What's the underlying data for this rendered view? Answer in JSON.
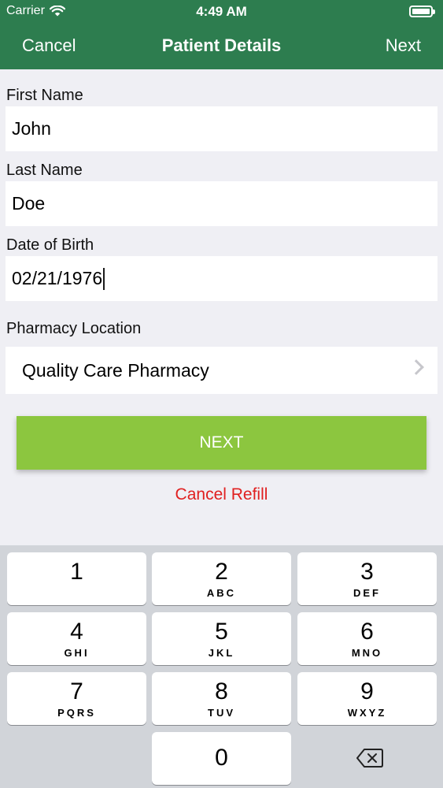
{
  "status_bar": {
    "carrier": "Carrier",
    "time": "4:49 AM"
  },
  "nav": {
    "cancel": "Cancel",
    "title": "Patient Details",
    "next": "Next"
  },
  "form": {
    "first_name_label": "First Name",
    "first_name_value": "John",
    "last_name_label": "Last Name",
    "last_name_value": "Doe",
    "dob_label": "Date of Birth",
    "dob_value": "02/21/1976",
    "pharmacy_label": "Pharmacy Location",
    "pharmacy_value": "Quality Care Pharmacy"
  },
  "actions": {
    "next_button": "NEXT",
    "cancel_refill": "Cancel Refill"
  },
  "keypad": {
    "keys": [
      {
        "num": "1",
        "letters": ""
      },
      {
        "num": "2",
        "letters": "ABC"
      },
      {
        "num": "3",
        "letters": "DEF"
      },
      {
        "num": "4",
        "letters": "GHI"
      },
      {
        "num": "5",
        "letters": "JKL"
      },
      {
        "num": "6",
        "letters": "MNO"
      },
      {
        "num": "7",
        "letters": "PQRS"
      },
      {
        "num": "8",
        "letters": "TUV"
      },
      {
        "num": "9",
        "letters": "WXYZ"
      },
      {
        "num": "0",
        "letters": ""
      }
    ],
    "delete_icon": "backspace-icon"
  },
  "colors": {
    "nav_bar": "#2d7d4f",
    "next_button": "#8cc63f",
    "cancel_refill": "#e02020"
  }
}
